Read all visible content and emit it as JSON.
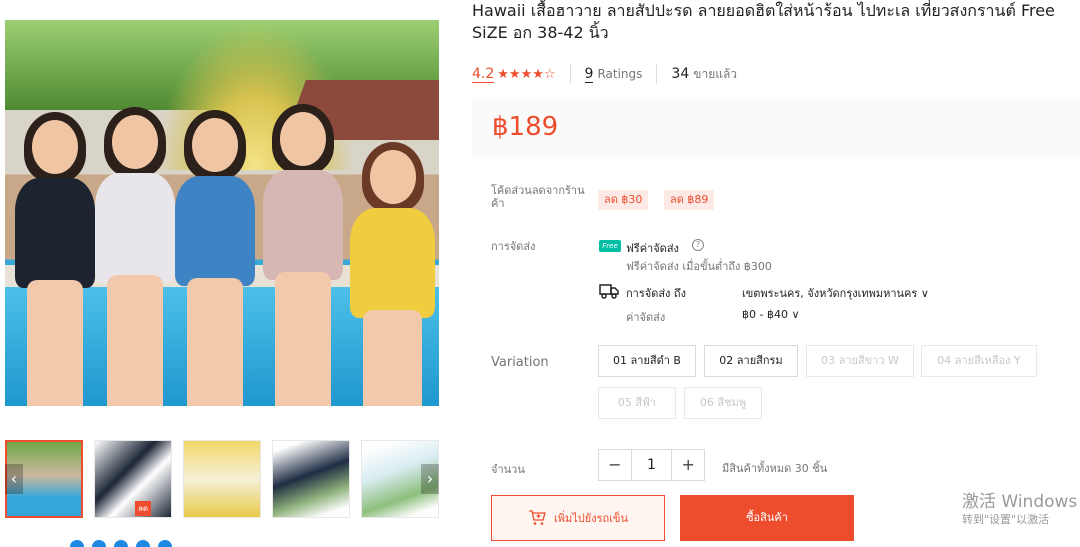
{
  "product": {
    "title": "Hawaii เสื้อฮาวาย ลายสัปปะรด ลายยอดฮิตใส่หน้าร้อน ไปทะเล เที่ยวสงกรานต์ Free\nSiZE อก 38-42 นิ้ว",
    "rating": "4.2",
    "stars": "★★★★☆",
    "ratings_count": "9",
    "ratings_label": "Ratings",
    "sold_count": "34",
    "sold_label": "ขายแล้ว",
    "price": "฿189"
  },
  "vouchers": {
    "label": "โค้ดส่วนลดจากร้านค้า",
    "items": [
      "ลด ฿30",
      "ลด ฿89"
    ]
  },
  "shipping": {
    "label": "การจัดส่ง",
    "free_badge": "Free",
    "free_title": "ฟรีค่าจัดส่ง",
    "free_sub": "ฟรีค่าจัดส่ง เมื่อขั้นต่ำถึง ฿300",
    "to_label": "การจัดส่ง ถึง",
    "to_value": "เขตพระนคร, จังหวัดกรุงเทพมหานคร ∨",
    "cost_label": "ค่าจัดส่ง",
    "cost_value": "฿0 - ฿40 ∨"
  },
  "variation": {
    "label": "Variation",
    "options": [
      {
        "label": "01 ลายสีดำ B",
        "enabled": true
      },
      {
        "label": "02 ลายสีกรม",
        "enabled": true
      },
      {
        "label": "03 ลายสีขาว W",
        "enabled": false
      },
      {
        "label": "04 ลายสีเหลือง Y",
        "enabled": false
      },
      {
        "label": "05 สีฟ้า",
        "enabled": false
      },
      {
        "label": "06 สีชมพู",
        "enabled": false
      }
    ]
  },
  "quantity": {
    "label": "จำนวน",
    "minus": "−",
    "value": "1",
    "plus": "+",
    "stock": "มีสินค้าทั้งหมด 30 ชิ้น"
  },
  "actions": {
    "add_to_cart": "เพิ่มไปยังรถเข็น",
    "buy_now": "ซื้อสินค้า"
  },
  "gallery": {
    "prev": "‹",
    "next": "›",
    "thumb_badge": "ลด"
  },
  "watermark": {
    "line1": "激活 Windows",
    "line2": "转到\"设置\"以激活"
  },
  "colors": {
    "accent": "#ee4d2d",
    "dots": [
      "#1e88e5",
      "#1e88e5",
      "#1e88e5",
      "#1e88e5",
      "#1e88e5"
    ]
  }
}
